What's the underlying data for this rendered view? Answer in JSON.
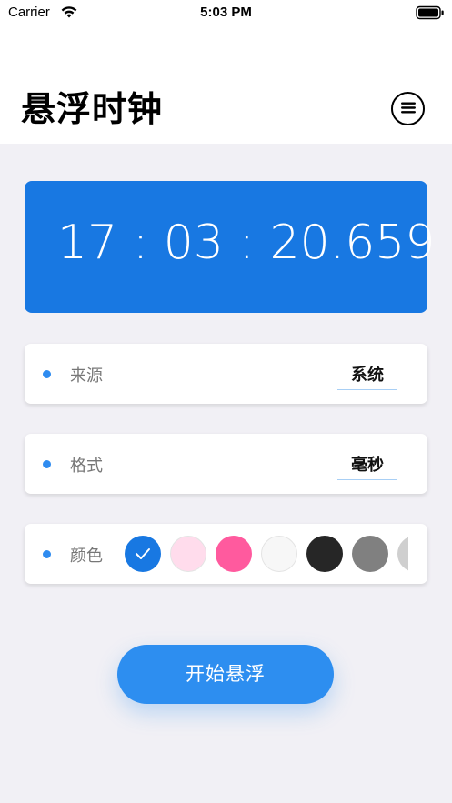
{
  "status_bar": {
    "carrier": "Carrier",
    "time": "5:03 PM"
  },
  "header": {
    "title": "悬浮时钟",
    "menu_icon": "menu-icon"
  },
  "clock": {
    "display": "17 : 03 : 20.659",
    "background": "#1878e2"
  },
  "settings": {
    "source": {
      "label": "来源",
      "value": "系统"
    },
    "format": {
      "label": "格式",
      "value": "毫秒"
    },
    "color": {
      "label": "颜色",
      "selected_index": 0,
      "swatches": [
        "#1878e2",
        "#ffdcec",
        "#ff5a9e",
        "#f7f7f7",
        "#262626",
        "#808080",
        "#cfcfcf"
      ]
    }
  },
  "actions": {
    "start_label": "开始悬浮"
  }
}
